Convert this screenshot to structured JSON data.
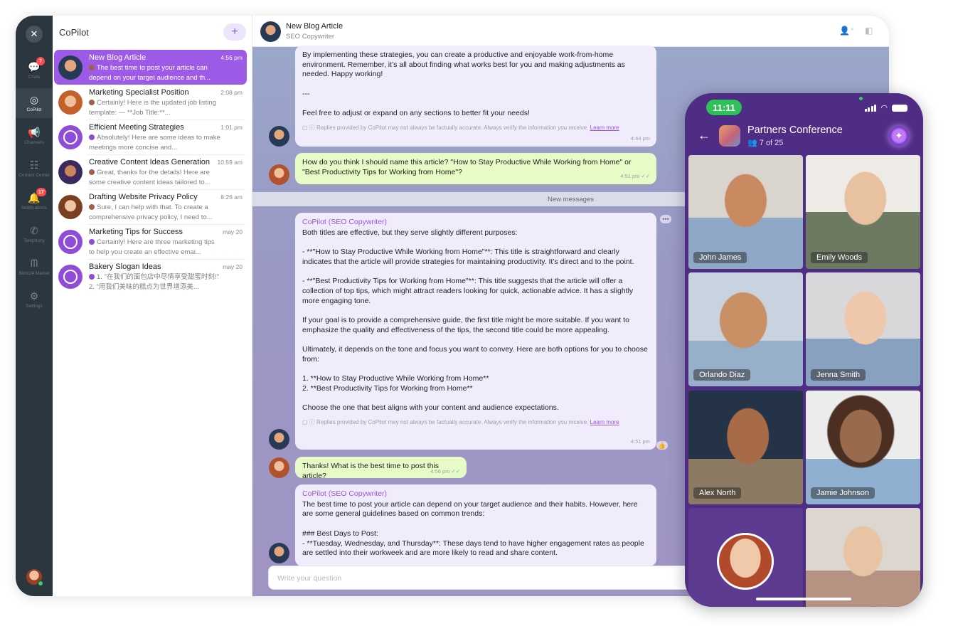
{
  "rail": {
    "items": [
      {
        "label": "Chats",
        "icon": "chat-bubbles-icon",
        "glyph": "💬",
        "badge": "7"
      },
      {
        "label": "CoPilot",
        "icon": "copilot-icon",
        "glyph": "◎",
        "badge": ""
      },
      {
        "label": "Channels",
        "icon": "megaphone-icon",
        "glyph": "📢",
        "badge": ""
      },
      {
        "label": "Contact Center",
        "icon": "contact-center-icon",
        "glyph": "☷",
        "badge": ""
      },
      {
        "label": "Notifications",
        "icon": "bell-icon",
        "glyph": "🔔",
        "badge": "17"
      },
      {
        "label": "Telephony",
        "icon": "phone-icon",
        "glyph": "✆",
        "badge": ""
      },
      {
        "label": "Bitrix24.Market",
        "icon": "market-icon",
        "glyph": "ᗰ",
        "badge": ""
      },
      {
        "label": "Settings",
        "icon": "gear-icon",
        "glyph": "⚙",
        "badge": ""
      }
    ]
  },
  "list": {
    "title": "CoPilot",
    "add_label": "+",
    "chats": [
      {
        "title": "New Blog Article",
        "time": "4:56 pm",
        "preview": "The best time to post your article can depend on your target audience and th..."
      },
      {
        "title": "Marketing Specialist Position",
        "time": "2:08 pm",
        "preview": "Certainly! Here is the updated job listing template: --- **Job Title:**..."
      },
      {
        "title": "Efficient Meeting Strategies",
        "time": "1:01 pm",
        "preview": "Absolutely! Here are some ideas to make meetings more concise and..."
      },
      {
        "title": "Creative Content Ideas Generation",
        "time": "10:59 am",
        "preview": "Great, thanks for the details! Here are some creative content ideas tailored to..."
      },
      {
        "title": "Drafting Website Privacy Policy",
        "time": "8:26 am",
        "preview": "Sure, I can help with that. To create a comprehensive privacy policy, I need to..."
      },
      {
        "title": "Marketing Tips for Success",
        "time": "may 20",
        "preview": "Certainly! Here are three marketing tips to help you create an effective emai..."
      },
      {
        "title": "Bakery Slogan Ideas",
        "time": "may 20",
        "preview": "1. \"在我们的面包店中尽情享受甜蜜时刻!\" 2. \"用我们美味的糕点为世界增添美..."
      }
    ]
  },
  "conversation": {
    "title": "New Blog Article",
    "subtitle": "SEO Copywriter",
    "msg1": "By implementing these strategies, you can create a productive and enjoyable work-from-home environment. Remember, it’s all about finding what works best for you and making adjustments as needed. Happy working!\n\n---\n\nFeel free to adjust or expand on any sections to better fit your needs!",
    "disclaimer_text": "Replies provided by CoPilot may not always be factually accurate. Always verify the information you receive.",
    "disclaimer_link": "Learn more",
    "msg1_time": "4:44 pm",
    "msg2": "How do you think I should name this article? \"How to Stay Productive While Working from Home\" or \"Best Productivity Tips for Working from Home\"?",
    "msg2_time": "4:51 pm",
    "new_messages": "New messages",
    "sender": "CoPilot (SEO Copywriter)",
    "msg3": "Both titles are effective, but they serve slightly different purposes:\n\n- **\"How to Stay Productive While Working from Home\"**: This title is straightforward and clearly indicates that the article will provide strategies for maintaining productivity. It’s direct and to the point.\n\n- **\"Best Productivity Tips for Working from Home\"**: This title suggests that the article will offer a collection of top tips, which might attract readers looking for quick, actionable advice. It has a slightly more engaging tone.\n\nIf your goal is to provide a comprehensive guide, the first title might be more suitable. If you want to emphasize the quality and effectiveness of the tips, the second title could be more appealing.\n\nUltimately, it depends on the tone and focus you want to convey. Here are both options for you to choose from:\n\n1. **How to Stay Productive While Working from Home**\n2. **Best Productivity Tips for Working from Home**\n\nChoose the one that best aligns with your content and audience expectations.",
    "msg3_time": "4:51 pm",
    "msg4": "Thanks! What is the best time to post this article?",
    "msg4_time": "4:56 pm",
    "msg5": "The best time to post your article can depend on your target audience and their habits. However, here are some general guidelines based on common trends:\n\n### Best Days to Post:\n- **Tuesday, Wednesday, and Thursday**: These days tend to have higher engagement rates as people are settled into their workweek and are more likely to read and share content.",
    "input_placeholder": "Write your question"
  },
  "phone": {
    "time": "11:11",
    "title": "Partners Conference",
    "count": "7 of 25",
    "participants": [
      "John James",
      "Emily Woods",
      "Orlando Diaz",
      "Jenna Smith",
      "Alex North",
      "Jamie Johnson"
    ]
  },
  "colors": {
    "accent": "#9c5ae6",
    "rail": "#2c363f",
    "phone": "#4f2d85",
    "online": "#2ec15a"
  }
}
